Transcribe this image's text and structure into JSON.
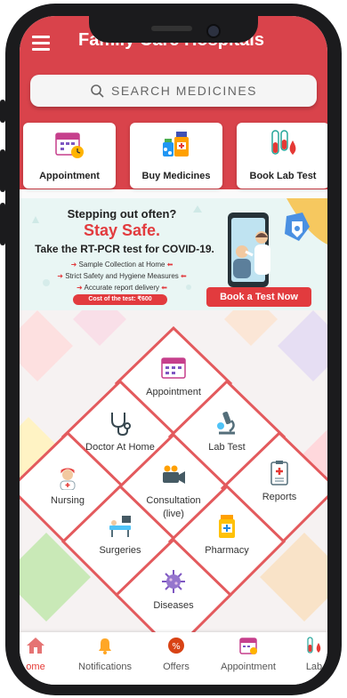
{
  "app": {
    "title": "Family Care Hospitals"
  },
  "search": {
    "placeholder": "SEARCH MEDICINES"
  },
  "quick_actions": [
    {
      "label": "Appointment",
      "icon": "calendar-icon"
    },
    {
      "label": "Buy Medicines",
      "icon": "medicines-icon"
    },
    {
      "label": "Book Lab Test",
      "icon": "test-tube-icon"
    }
  ],
  "banner": {
    "line1": "Stepping out often?",
    "line2": "Stay Safe.",
    "line3": "Take the RT-PCR test for COVID-19.",
    "bullets": [
      "Sample Collection at Home",
      "Strict Safety and Hygiene Measures",
      "Accurate report delivery"
    ],
    "cost": "Cost of the test: ₹600",
    "cta": "Book a Test Now",
    "colors": {
      "accent": "#e23b3e",
      "background": "#e9f6f4"
    }
  },
  "services": [
    {
      "label": "Appointment",
      "icon": "calendar-icon"
    },
    {
      "label": "Doctor At Home",
      "icon": "stethoscope-icon"
    },
    {
      "label": "Lab Test",
      "icon": "microscope-icon"
    },
    {
      "label": "Nursing",
      "icon": "nurse-icon"
    },
    {
      "label": "Consultation (live)",
      "icon": "video-camera-icon"
    },
    {
      "label": "Reports",
      "icon": "report-icon"
    },
    {
      "label": "Surgeries",
      "icon": "surgery-icon"
    },
    {
      "label": "Pharmacy",
      "icon": "pharmacy-icon"
    },
    {
      "label": "Diseases",
      "icon": "virus-icon"
    }
  ],
  "bottom_nav": [
    {
      "label": "ome",
      "icon": "home-icon"
    },
    {
      "label": "Notifications",
      "icon": "bell-icon"
    },
    {
      "label": "Offers",
      "icon": "offers-icon"
    },
    {
      "label": "Appointment",
      "icon": "calendar-icon"
    },
    {
      "label": "Lab",
      "icon": "test-tube-icon"
    }
  ],
  "colors": {
    "primary": "#d9434b",
    "accent": "#e23b3e"
  }
}
